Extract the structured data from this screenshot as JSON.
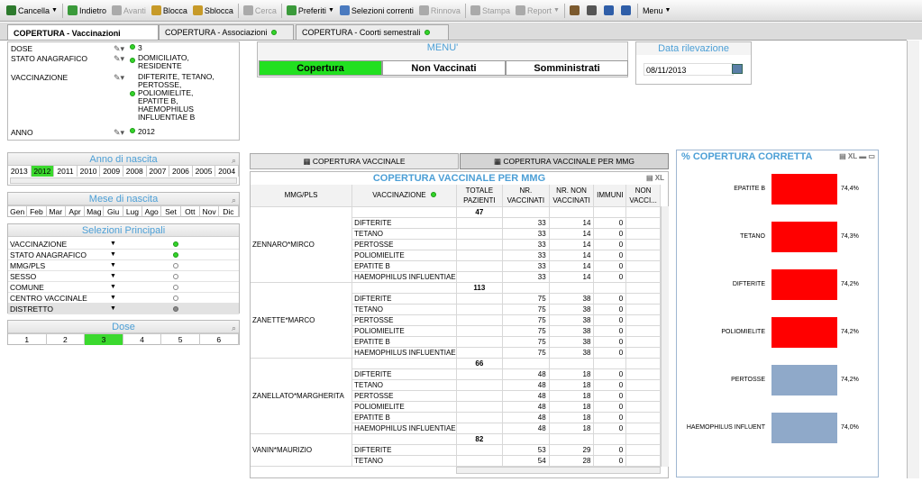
{
  "toolbar": {
    "items": [
      {
        "label": "Cancella",
        "icon": "cancel-icon",
        "enabled": true,
        "dropdown": true
      },
      {
        "label": "Indietro",
        "icon": "back-icon",
        "enabled": true,
        "dropdown": false
      },
      {
        "label": "Avanti",
        "icon": "forward-icon",
        "enabled": false,
        "dropdown": false
      },
      {
        "label": "Blocca",
        "icon": "lock-icon",
        "enabled": true,
        "dropdown": false
      },
      {
        "label": "Sblocca",
        "icon": "unlock-icon",
        "enabled": true,
        "dropdown": false
      },
      {
        "label": "Cerca",
        "icon": "search-icon",
        "enabled": false,
        "dropdown": false
      },
      {
        "label": "Preferiti",
        "icon": "star-icon",
        "enabled": true,
        "dropdown": true
      },
      {
        "label": "Selezioni correnti",
        "icon": "checklist-icon",
        "enabled": true,
        "dropdown": false
      },
      {
        "label": "Rinnova",
        "icon": "refresh-icon",
        "enabled": false,
        "dropdown": false
      },
      {
        "label": "Stampa",
        "icon": "print-icon",
        "enabled": false,
        "dropdown": false
      },
      {
        "label": "Report",
        "icon": "report-icon",
        "enabled": false,
        "dropdown": true
      },
      {
        "label": "",
        "icon": "users-icon",
        "enabled": true,
        "dropdown": false
      },
      {
        "label": "",
        "icon": "edit-icon",
        "enabled": true,
        "dropdown": false
      },
      {
        "label": "",
        "icon": "help-icon",
        "enabled": true,
        "dropdown": false
      },
      {
        "label": "",
        "icon": "help-cursor-icon",
        "enabled": true,
        "dropdown": false
      },
      {
        "label": "Menu",
        "icon": "",
        "enabled": true,
        "dropdown": true
      }
    ]
  },
  "tabs": [
    {
      "label": "COPERTURA - Vaccinazioni",
      "active": true,
      "dot": false
    },
    {
      "label": "COPERTURA - Associazioni",
      "active": false,
      "dot": true
    },
    {
      "label": "COPERTURA - Coorti semestrali",
      "active": false,
      "dot": true
    }
  ],
  "current_selections": [
    {
      "field": "DOSE",
      "value": "3"
    },
    {
      "field": "STATO ANAGRAFICO",
      "value": "DOMICILIATO, RESIDENTE"
    },
    {
      "field": "VACCINAZIONE",
      "value": "DIFTERITE, TETANO, PERTOSSE, POLIOMIELITE, EPATITE B, HAEMOPHILUS INFLUENTIAE B"
    },
    {
      "field": "ANNO",
      "value": "2012"
    }
  ],
  "menu": {
    "title": "MENU'",
    "buttons": [
      "Copertura",
      "Non Vaccinati",
      "Somministrati"
    ],
    "active": 0
  },
  "data_rilevazione": {
    "title": "Data rilevazione",
    "value": "08/11/2013"
  },
  "anno_nascita": {
    "title": "Anno di nascita",
    "years": [
      "2013",
      "2012",
      "2011",
      "2010",
      "2009",
      "2008",
      "2007",
      "2006",
      "2005",
      "2004"
    ],
    "selected": "2012"
  },
  "mese_nascita": {
    "title": "Mese di nascita",
    "months": [
      "Gen",
      "Feb",
      "Mar",
      "Apr",
      "Mag",
      "Giu",
      "Lug",
      "Ago",
      "Set",
      "Ott",
      "Nov",
      "Dic"
    ]
  },
  "selezioni_principali": {
    "title": "Selezioni Principali",
    "items": [
      {
        "label": "VACCINAZIONE",
        "state": "selected"
      },
      {
        "label": "STATO ANAGRAFICO",
        "state": "selected"
      },
      {
        "label": "MMG/PLS",
        "state": "empty"
      },
      {
        "label": "SESSO",
        "state": "empty"
      },
      {
        "label": "COMUNE",
        "state": "empty"
      },
      {
        "label": "CENTRO VACCINALE",
        "state": "empty"
      },
      {
        "label": "DISTRETTO",
        "state": "excluded"
      }
    ]
  },
  "dose": {
    "title": "Dose",
    "values": [
      "1",
      "2",
      "3",
      "4",
      "5",
      "6"
    ],
    "selected": "3"
  },
  "table_tabs": [
    "COPERTURA VACCINALE",
    "COPERTURA VACCINALE PER MMG"
  ],
  "table": {
    "title": "COPERTURA VACCINALE PER MMG",
    "headers": [
      "MMG/PLS",
      "VACCINAZIONE",
      "TOTALE PAZIENTI",
      "NR. VACCINATI",
      "NR. NON VACCINATI",
      "IMMUNI",
      "NON VACCI..."
    ],
    "groups": [
      {
        "name": "ZENNARO*MIRCO",
        "total": "47",
        "rows": [
          [
            "DIFTERITE",
            "33",
            "14",
            "0"
          ],
          [
            "TETANO",
            "33",
            "14",
            "0"
          ],
          [
            "PERTOSSE",
            "33",
            "14",
            "0"
          ],
          [
            "POLIOMIELITE",
            "33",
            "14",
            "0"
          ],
          [
            "EPATITE B",
            "33",
            "14",
            "0"
          ],
          [
            "HAEMOPHILUS INFLUENTIAE",
            "33",
            "14",
            "0"
          ]
        ]
      },
      {
        "name": "ZANETTE*MARCO",
        "total": "113",
        "rows": [
          [
            "DIFTERITE",
            "75",
            "38",
            "0"
          ],
          [
            "TETANO",
            "75",
            "38",
            "0"
          ],
          [
            "PERTOSSE",
            "75",
            "38",
            "0"
          ],
          [
            "POLIOMIELITE",
            "75",
            "38",
            "0"
          ],
          [
            "EPATITE B",
            "75",
            "38",
            "0"
          ],
          [
            "HAEMOPHILUS INFLUENTIAE",
            "75",
            "38",
            "0"
          ]
        ]
      },
      {
        "name": "ZANELLATO*MARGHERITA",
        "total": "66",
        "rows": [
          [
            "DIFTERITE",
            "48",
            "18",
            "0"
          ],
          [
            "TETANO",
            "48",
            "18",
            "0"
          ],
          [
            "PERTOSSE",
            "48",
            "18",
            "0"
          ],
          [
            "POLIOMIELITE",
            "48",
            "18",
            "0"
          ],
          [
            "EPATITE B",
            "48",
            "18",
            "0"
          ],
          [
            "HAEMOPHILUS INFLUENTIAE",
            "48",
            "18",
            "0"
          ]
        ]
      },
      {
        "name": "VANIN*MAURIZIO",
        "total": "82",
        "rows": [
          [
            "DIFTERITE",
            "53",
            "29",
            "0"
          ],
          [
            "TETANO",
            "54",
            "28",
            "0"
          ]
        ]
      }
    ]
  },
  "chart_data": {
    "type": "bar",
    "title": "% COPERTURA CORRETTA",
    "categories": [
      "EPATITE B",
      "TETANO",
      "DIFTERITE",
      "POLIOMIELITE",
      "PERTOSSE",
      "HAEMOPHILUS INFLUENT"
    ],
    "values": [
      74.4,
      74.3,
      74.2,
      74.2,
      74.2,
      74.0
    ],
    "labels": [
      "74,4%",
      "74,3%",
      "74,2%",
      "74,2%",
      "74,2%",
      "74,0%"
    ],
    "colors": [
      "#ff0000",
      "#ff0000",
      "#ff0000",
      "#ff0000",
      "#8fa9c9",
      "#8fa9c9"
    ]
  }
}
